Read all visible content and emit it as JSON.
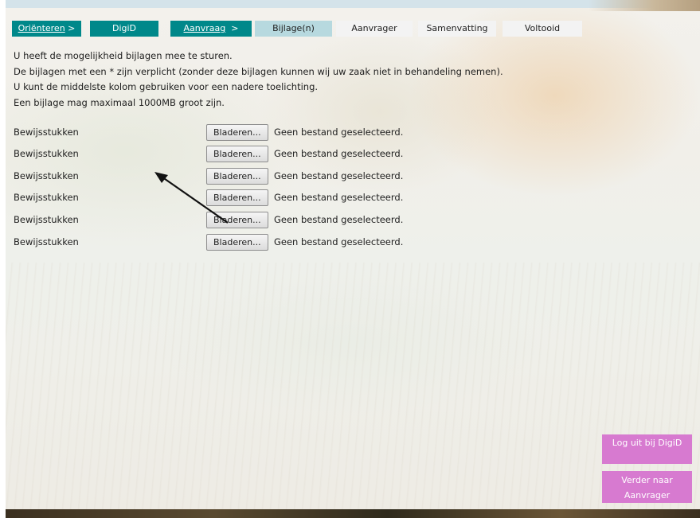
{
  "steps": [
    {
      "label": "Oriënteren",
      "suffix": " >",
      "state": "done",
      "linked": true
    },
    {
      "label": "DigiD",
      "suffix": "",
      "state": "done",
      "linked": false
    },
    {
      "label": "Aanvraag",
      "suffix": "  >",
      "state": "done",
      "linked": true
    },
    {
      "label": "Bijlage(n)",
      "suffix": "",
      "state": "current",
      "linked": false
    },
    {
      "label": "Aanvrager",
      "suffix": "",
      "state": "todo",
      "linked": false
    },
    {
      "label": "Samenvatting",
      "suffix": "",
      "state": "todo",
      "linked": false
    },
    {
      "label": "Voltooid",
      "suffix": "",
      "state": "todo",
      "linked": false
    }
  ],
  "intro": [
    "U heeft de mogelijkheid bijlagen mee te sturen.",
    "De bijlagen met een * zijn verplicht (zonder deze bijlagen kunnen wij uw zaak niet in behandeling nemen).",
    "U kunt de middelste kolom gebruiken voor een nadere toelichting.",
    "Een bijlage mag maximaal 1000MB groot zijn."
  ],
  "attachments": [
    {
      "label": "Bewijsstukken",
      "button": "Bladeren...",
      "status": "Geen bestand geselecteerd."
    },
    {
      "label": "Bewijsstukken",
      "button": "Bladeren...",
      "status": "Geen bestand geselecteerd."
    },
    {
      "label": "Bewijsstukken",
      "button": "Bladeren...",
      "status": "Geen bestand geselecteerd."
    },
    {
      "label": "Bewijsstukken",
      "button": "Bladeren...",
      "status": "Geen bestand geselecteerd."
    },
    {
      "label": "Bewijsstukken",
      "button": "Bladeren...",
      "status": "Geen bestand geselecteerd."
    },
    {
      "label": "Bewijsstukken",
      "button": "Bladeren...",
      "status": "Geen bestand geselecteerd."
    }
  ],
  "actions": {
    "logout": "Log uit bij DigiD",
    "next_line1": "Verder naar",
    "next_line2": "Aanvrager"
  },
  "colors": {
    "step_done": "#00888a",
    "step_current": "#b7d9df",
    "step_todo": "#f3f3f3",
    "action_button": "#d77ad0"
  }
}
